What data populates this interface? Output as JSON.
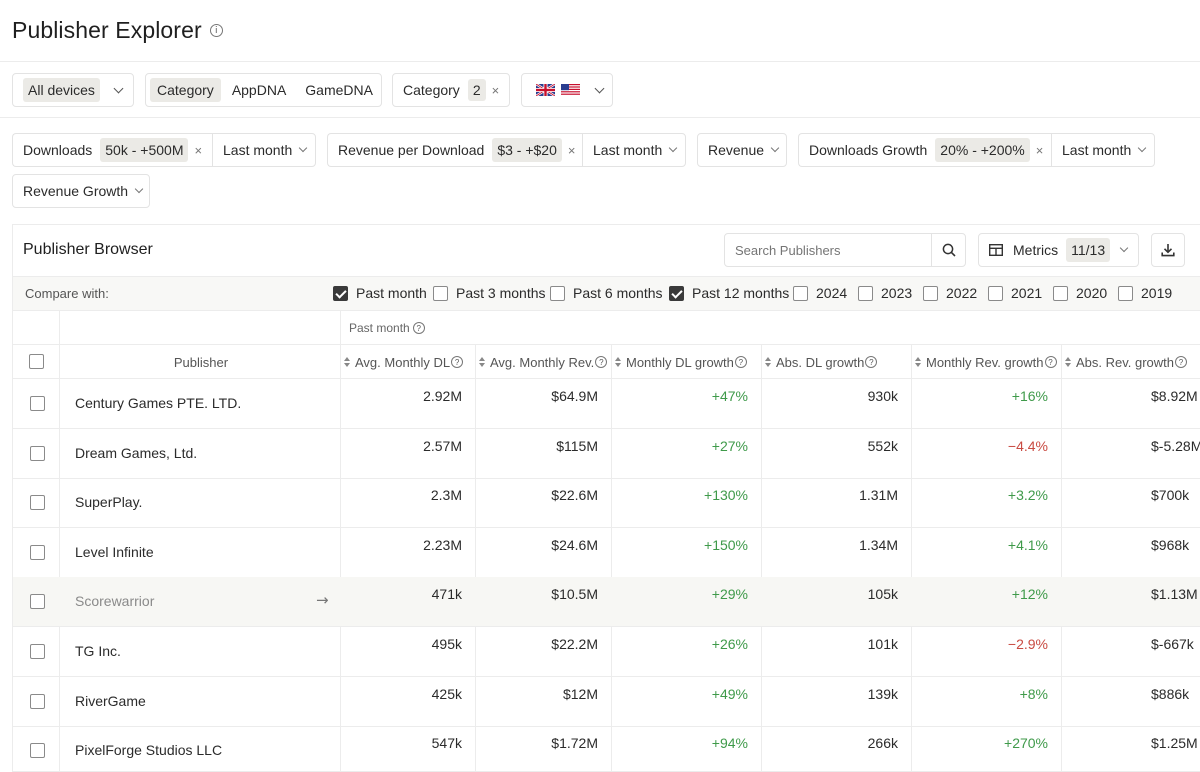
{
  "page": {
    "title": "Publisher Explorer"
  },
  "filters_row1": {
    "devices": "All devices",
    "tabs": [
      "Category",
      "AppDNA",
      "GameDNA"
    ],
    "category_label": "Category",
    "category_count": "2",
    "flags": [
      "uk-flag",
      "us-flag"
    ]
  },
  "filters_row2": {
    "downloads": {
      "label": "Downloads",
      "value": "50k - +500M"
    },
    "downloads_period": "Last month",
    "rpd": {
      "label": "Revenue per Download",
      "value": "$3 - +$20"
    },
    "rpd_period": "Last month",
    "revenue": "Revenue",
    "dl_growth": {
      "label": "Downloads Growth",
      "value": "20% - +200%"
    },
    "dl_growth_period": "Last month",
    "rev_growth": "Revenue Growth"
  },
  "browser": {
    "title": "Publisher Browser",
    "search_placeholder": "Search Publishers",
    "metrics_label": "Metrics",
    "metrics_count": "11/13"
  },
  "compare": {
    "label": "Compare with:",
    "options": [
      {
        "label": "Past month",
        "checked": true
      },
      {
        "label": "Past 3 months",
        "checked": false
      },
      {
        "label": "Past 6 months",
        "checked": false
      },
      {
        "label": "Past 12 months",
        "checked": true
      },
      {
        "label": "2024",
        "checked": false
      },
      {
        "label": "2023",
        "checked": false
      },
      {
        "label": "2022",
        "checked": false
      },
      {
        "label": "2021",
        "checked": false
      },
      {
        "label": "2020",
        "checked": false
      },
      {
        "label": "2019",
        "checked": false
      }
    ]
  },
  "table": {
    "group_label": "Past month",
    "publisher_header": "Publisher",
    "columns": [
      "Avg. Monthly DL",
      "Avg. Monthly Rev.",
      "Monthly DL growth",
      "Abs. DL growth",
      "Monthly Rev. growth",
      "Abs. Rev. growth"
    ],
    "rows": [
      {
        "publisher": "Century Games PTE. LTD.",
        "values": [
          "2.92M",
          "$64.9M",
          "+47%",
          "930k",
          "+16%",
          "$8.92M"
        ]
      },
      {
        "publisher": "Dream Games, Ltd.",
        "values": [
          "2.57M",
          "$115M",
          "+27%",
          "552k",
          "−4.4%",
          "$-5.28M"
        ]
      },
      {
        "publisher": "SuperPlay.",
        "values": [
          "2.3M",
          "$22.6M",
          "+130%",
          "1.31M",
          "+3.2%",
          "$700k"
        ]
      },
      {
        "publisher": "Level Infinite",
        "values": [
          "2.23M",
          "$24.6M",
          "+150%",
          "1.34M",
          "+4.1%",
          "$968k"
        ]
      },
      {
        "publisher": "Scorewarrior",
        "values": [
          "471k",
          "$10.5M",
          "+29%",
          "105k",
          "+12%",
          "$1.13M"
        ]
      },
      {
        "publisher": "TG Inc.",
        "values": [
          "495k",
          "$22.2M",
          "+26%",
          "101k",
          "−2.9%",
          "$-667k"
        ]
      },
      {
        "publisher": "RiverGame",
        "values": [
          "425k",
          "$12M",
          "+49%",
          "139k",
          "+8%",
          "$886k"
        ]
      },
      {
        "publisher": "PixelForge Studios LLC",
        "values": [
          "547k",
          "$1.72M",
          "+94%",
          "266k",
          "+270%",
          "$1.25M"
        ]
      }
    ]
  },
  "colors": {
    "positive": "#3f9a4a",
    "negative": "#c94b42",
    "chip": "#ebeae6",
    "highlight_row": "#f7f7f4"
  }
}
